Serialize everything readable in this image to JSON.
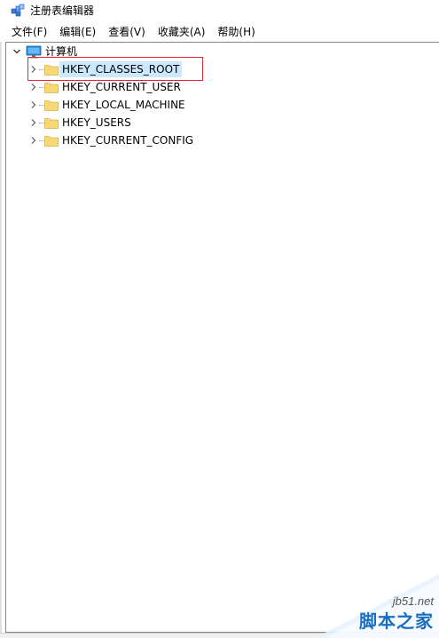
{
  "window": {
    "title": "注册表编辑器",
    "icon": "regedit-icon"
  },
  "menu": {
    "items": [
      {
        "label": "文件(F)"
      },
      {
        "label": "编辑(E)"
      },
      {
        "label": "查看(V)"
      },
      {
        "label": "收藏夹(A)"
      },
      {
        "label": "帮助(H)"
      }
    ]
  },
  "tree": {
    "root": {
      "label": "计算机",
      "icon": "computer-icon",
      "expanded": true
    },
    "children": [
      {
        "label": "HKEY_CLASSES_ROOT",
        "selected": true
      },
      {
        "label": "HKEY_CURRENT_USER",
        "selected": false
      },
      {
        "label": "HKEY_LOCAL_MACHINE",
        "selected": false
      },
      {
        "label": "HKEY_USERS",
        "selected": false
      },
      {
        "label": "HKEY_CURRENT_CONFIG",
        "selected": false
      }
    ]
  },
  "colors": {
    "selection": "#cce8ff",
    "highlight_box": "#e0282b",
    "folder": "#f8d775",
    "watermark_blue": "#1b6dc1"
  },
  "watermark": {
    "site": "jb51.net",
    "brand": "脚本之家"
  }
}
